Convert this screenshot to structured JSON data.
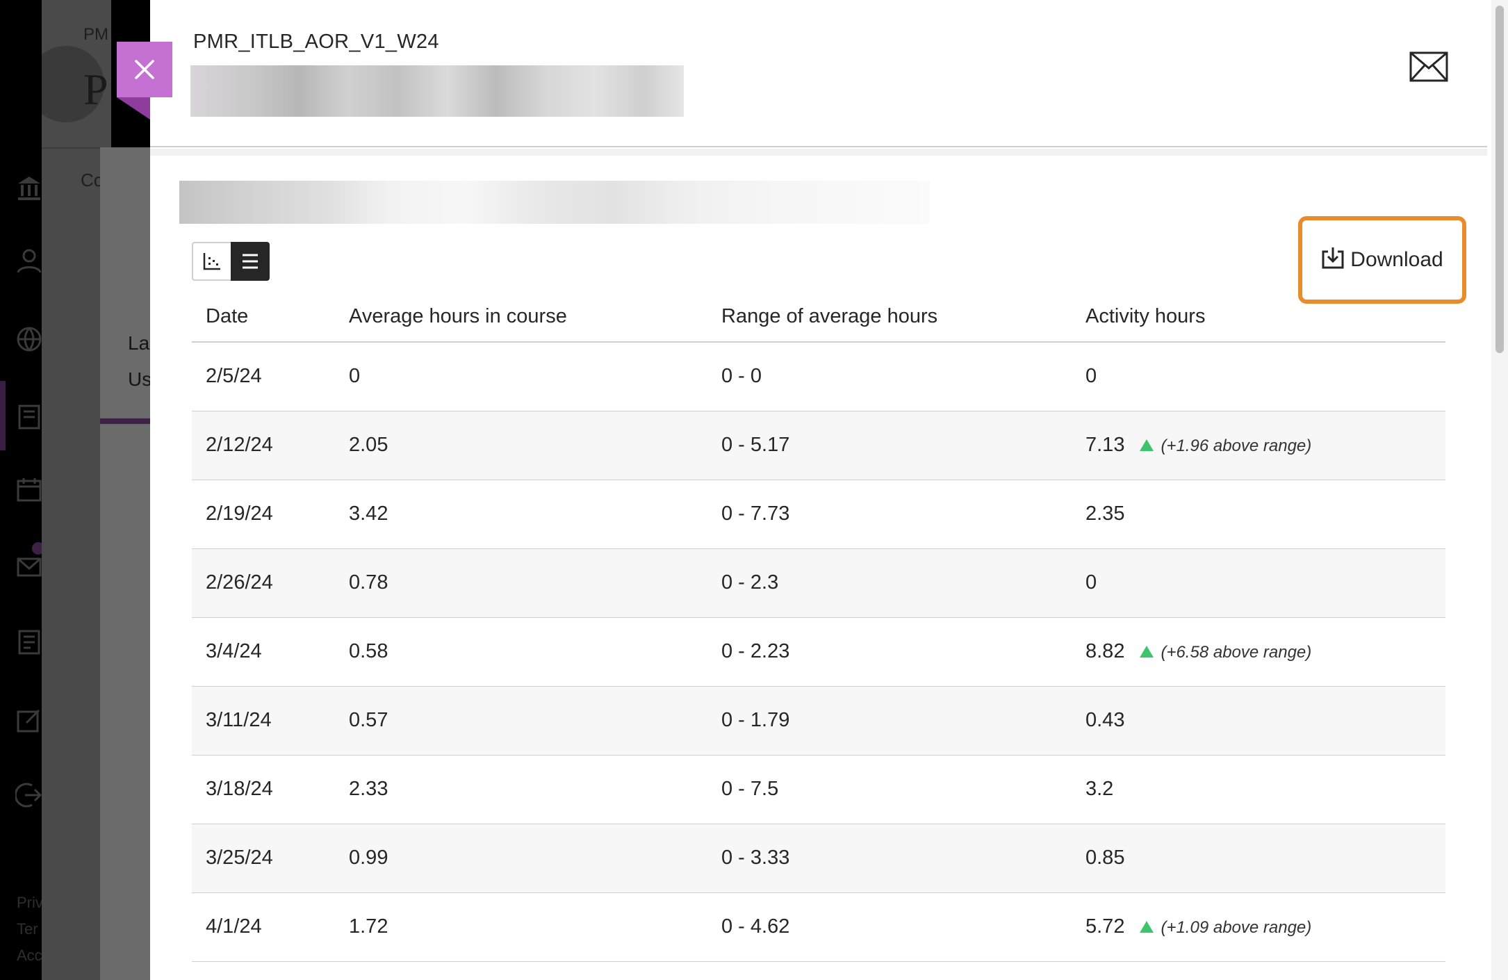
{
  "background": {
    "breadcrumb": "PM",
    "breadcrumb_2": "P",
    "page_title_initial": "P",
    "tab_initial": "Co",
    "card_line_1": "La",
    "card_line_2": "Us",
    "footer_links": [
      "Priv",
      "Ter",
      "Acc"
    ]
  },
  "panel": {
    "title": "PMR_ITLB_AOR_V1_W24",
    "download_label": "Download",
    "view_options": [
      "chart-view",
      "list-view"
    ],
    "selected_view": "list-view"
  },
  "table": {
    "headers": [
      "Date",
      "Average hours in course",
      "Range of average hours",
      "Activity hours"
    ],
    "rows": [
      {
        "date": "2/5/24",
        "avg": "0",
        "range": "0 - 0",
        "activity": "0",
        "note": ""
      },
      {
        "date": "2/12/24",
        "avg": "2.05",
        "range": "0 - 5.17",
        "activity": "7.13",
        "note": "(+1.96 above range)"
      },
      {
        "date": "2/19/24",
        "avg": "3.42",
        "range": "0 - 7.73",
        "activity": "2.35",
        "note": ""
      },
      {
        "date": "2/26/24",
        "avg": "0.78",
        "range": "0 - 2.3",
        "activity": "0",
        "note": ""
      },
      {
        "date": "3/4/24",
        "avg": "0.58",
        "range": "0 - 2.23",
        "activity": "8.82",
        "note": "(+6.58 above range)"
      },
      {
        "date": "3/11/24",
        "avg": "0.57",
        "range": "0 - 1.79",
        "activity": "0.43",
        "note": ""
      },
      {
        "date": "3/18/24",
        "avg": "2.33",
        "range": "0 - 7.5",
        "activity": "3.2",
        "note": ""
      },
      {
        "date": "3/25/24",
        "avg": "0.99",
        "range": "0 - 3.33",
        "activity": "0.85",
        "note": ""
      },
      {
        "date": "4/1/24",
        "avg": "1.72",
        "range": "0 - 4.62",
        "activity": "5.72",
        "note": "(+1.09 above range)"
      }
    ]
  },
  "colors": {
    "close_button": "#c471d3",
    "download_highlight": "#e88d2b",
    "above_range_arrow": "#3ec46d"
  },
  "icons": {
    "close": "close-icon",
    "mail": "mail-icon",
    "download": "download-icon",
    "chart_view": "chart-icon",
    "list_view": "list-icon"
  }
}
